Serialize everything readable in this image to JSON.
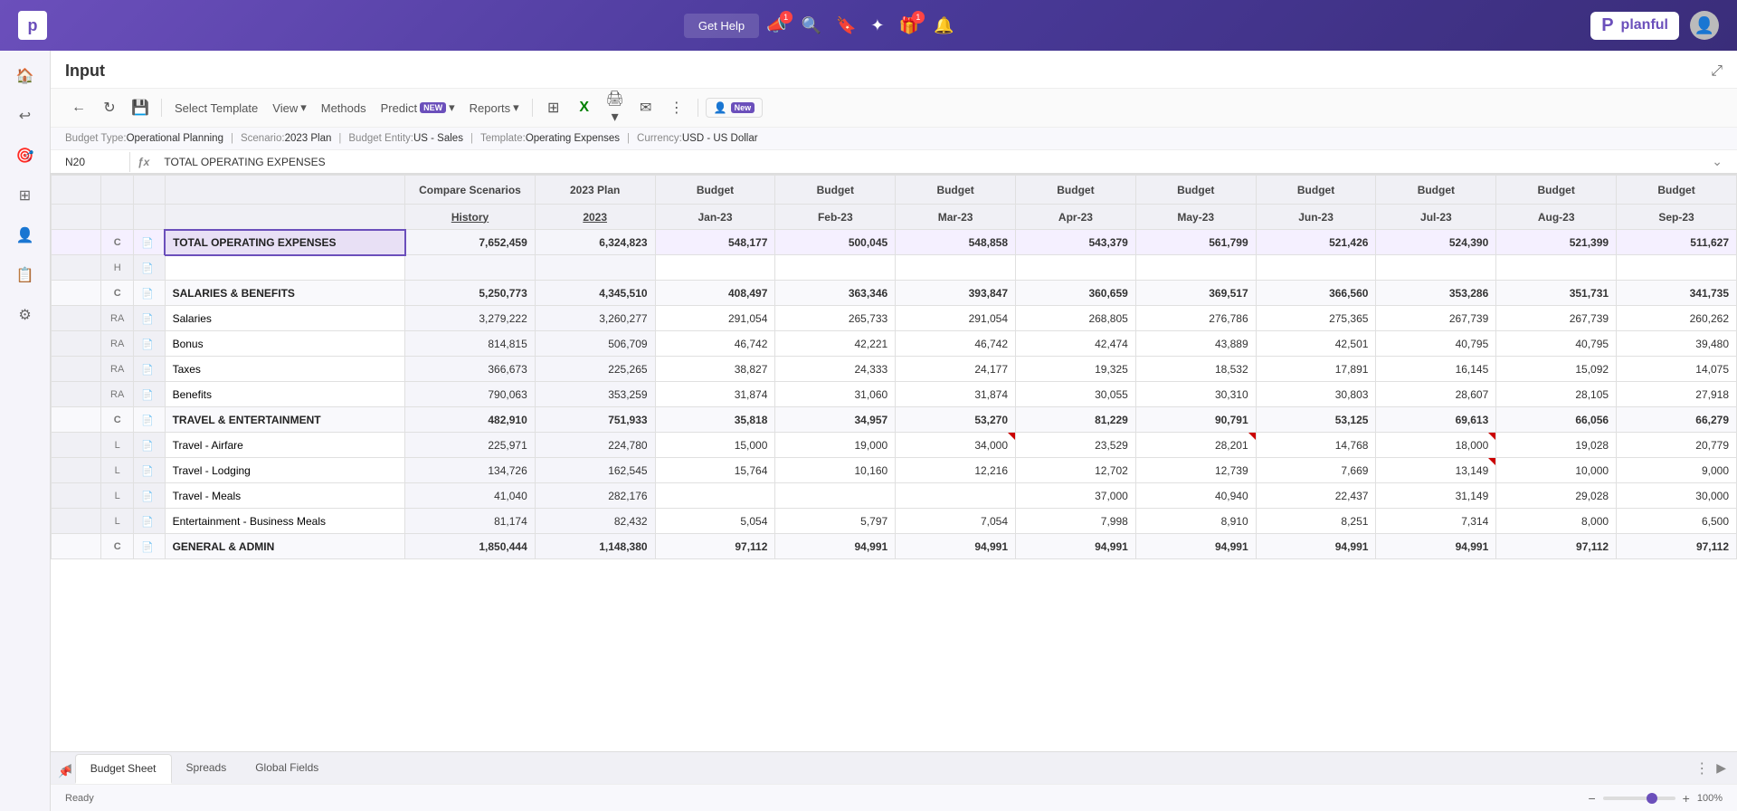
{
  "app": {
    "title": "Input",
    "logo_letter": "P",
    "logo_name": "planful"
  },
  "top_nav": {
    "get_help": "Get Help",
    "icons": [
      "megaphone",
      "search",
      "bookmark",
      "compass",
      "gift",
      "bell"
    ]
  },
  "toolbar": {
    "select_template": "Select Template",
    "view": "View",
    "methods": "Methods",
    "predict": "Predict",
    "reports": "Reports",
    "new_badge": "NEW",
    "new_label": "New"
  },
  "info_bar": {
    "budget_type_label": "Budget Type:",
    "budget_type_value": "Operational Planning",
    "scenario_label": "Scenario:",
    "scenario_value": "2023 Plan",
    "entity_label": "Budget Entity:",
    "entity_value": "US - Sales",
    "template_label": "Template:",
    "template_value": "Operating Expenses",
    "currency_label": "Currency:",
    "currency_value": "USD - US Dollar"
  },
  "formula_bar": {
    "cell_ref": "N20",
    "formula_text": "TOTAL OPERATING EXPENSES"
  },
  "table": {
    "col_headers_row1": [
      "Compare Scenarios",
      "2023 Plan",
      "Budget",
      "Budget",
      "Budget",
      "Budget",
      "Budget",
      "Budget",
      "Budget",
      "Budget",
      "Budget"
    ],
    "col_headers_row2": [
      "History",
      "2023",
      "Jan-23",
      "Feb-23",
      "Mar-23",
      "Apr-23",
      "May-23",
      "Jun-23",
      "Jul-23",
      "Aug-23",
      "Sep-23"
    ],
    "rows": [
      {
        "type": "C",
        "icon": true,
        "name": "TOTAL OPERATING EXPENSES",
        "is_total": true,
        "selected": true,
        "values": [
          "7,652,459",
          "6,324,823",
          "548,177",
          "500,045",
          "548,858",
          "543,379",
          "561,799",
          "521,426",
          "524,390",
          "521,399",
          "511,627"
        ]
      },
      {
        "type": "H",
        "icon": true,
        "name": "",
        "is_total": false,
        "selected": false,
        "values": [
          "",
          "",
          "",
          "",
          "",
          "",
          "",
          "",
          "",
          "",
          ""
        ]
      },
      {
        "type": "C",
        "icon": true,
        "name": "SALARIES & BENEFITS",
        "is_total": false,
        "selected": false,
        "values": [
          "5,250,773",
          "4,345,510",
          "408,497",
          "363,346",
          "393,847",
          "360,659",
          "369,517",
          "366,560",
          "353,286",
          "351,731",
          "341,735"
        ]
      },
      {
        "type": "RA",
        "icon": true,
        "name": "Salaries",
        "is_total": false,
        "selected": false,
        "values": [
          "3,279,222",
          "3,260,277",
          "291,054",
          "265,733",
          "291,054",
          "268,805",
          "276,786",
          "275,365",
          "267,739",
          "267,739",
          "260,262"
        ]
      },
      {
        "type": "RA",
        "icon": true,
        "name": "Bonus",
        "is_total": false,
        "selected": false,
        "values": [
          "814,815",
          "506,709",
          "46,742",
          "42,221",
          "46,742",
          "42,474",
          "43,889",
          "42,501",
          "40,795",
          "40,795",
          "39,480"
        ]
      },
      {
        "type": "RA",
        "icon": true,
        "name": "Taxes",
        "is_total": false,
        "selected": false,
        "values": [
          "366,673",
          "225,265",
          "38,827",
          "24,333",
          "24,177",
          "19,325",
          "18,532",
          "17,891",
          "16,145",
          "15,092",
          "14,075"
        ]
      },
      {
        "type": "RA",
        "icon": true,
        "name": "Benefits",
        "is_total": false,
        "selected": false,
        "values": [
          "790,063",
          "353,259",
          "31,874",
          "31,060",
          "31,874",
          "30,055",
          "30,310",
          "30,803",
          "28,607",
          "28,105",
          "27,918"
        ]
      },
      {
        "type": "C",
        "icon": true,
        "name": "TRAVEL & ENTERTAINMENT",
        "is_total": false,
        "selected": false,
        "values": [
          "482,910",
          "751,933",
          "35,818",
          "34,957",
          "53,270",
          "81,229",
          "90,791",
          "53,125",
          "69,613",
          "66,056",
          "66,279"
        ]
      },
      {
        "type": "L",
        "icon": true,
        "name": "Travel - Airfare",
        "is_total": false,
        "selected": false,
        "red_corners": [
          4,
          6,
          8
        ],
        "values": [
          "225,971",
          "224,780",
          "15,000",
          "19,000",
          "34,000",
          "23,529",
          "28,201",
          "14,768",
          "18,000",
          "19,028",
          "20,779"
        ]
      },
      {
        "type": "L",
        "icon": true,
        "name": "Travel - Lodging",
        "is_total": false,
        "selected": false,
        "red_corners": [
          8
        ],
        "values": [
          "134,726",
          "162,545",
          "15,764",
          "10,160",
          "12,216",
          "12,702",
          "12,739",
          "7,669",
          "13,149",
          "10,000",
          "9,000"
        ]
      },
      {
        "type": "L",
        "icon": true,
        "name": "Travel - Meals",
        "is_total": false,
        "selected": false,
        "values": [
          "41,040",
          "282,176",
          "",
          "",
          "",
          "37,000",
          "40,940",
          "22,437",
          "31,149",
          "29,028",
          "30,000"
        ]
      },
      {
        "type": "L",
        "icon": true,
        "name": "Entertainment - Business Meals",
        "is_total": false,
        "selected": false,
        "values": [
          "81,174",
          "82,432",
          "5,054",
          "5,797",
          "7,054",
          "7,998",
          "8,910",
          "8,251",
          "7,314",
          "8,000",
          "6,500"
        ]
      },
      {
        "type": "C",
        "icon": true,
        "name": "GENERAL & ADMIN",
        "is_total": false,
        "selected": false,
        "values": [
          "1,850,444",
          "1,148,380",
          "97,112",
          "94,991",
          "94,991",
          "94,991",
          "94,991",
          "94,991",
          "94,991",
          "97,112",
          "97,112"
        ]
      }
    ]
  },
  "tabs": {
    "items": [
      "Budget Sheet",
      "Spreads",
      "Global Fields"
    ],
    "active": "Budget Sheet"
  },
  "status": {
    "ready": "Ready",
    "zoom": "100%"
  }
}
